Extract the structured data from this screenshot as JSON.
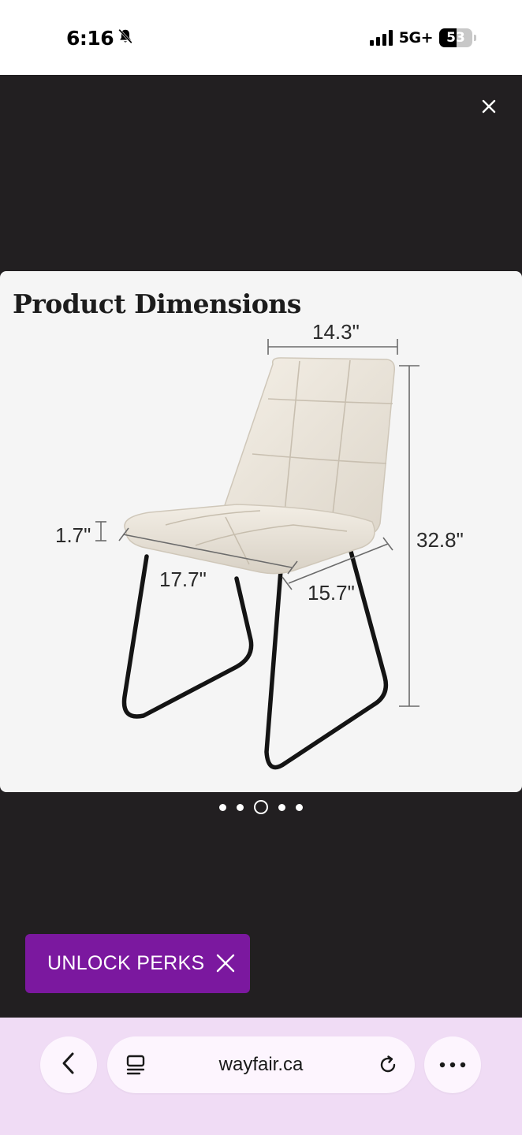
{
  "status_bar": {
    "time": "6:16",
    "network": "5G+",
    "battery_level": "53",
    "battery_fraction": 0.53,
    "icons": [
      "bell-slash-icon",
      "signal-bars-icon",
      "battery-icon"
    ]
  },
  "viewer": {
    "close_icon": "close-icon",
    "image": {
      "title": "Product Dimensions",
      "dimensions": {
        "width": "14.3\"",
        "height": "32.8\"",
        "seat_thickness": "1.7\"",
        "seat_width": "17.7\"",
        "seat_depth": "15.7\""
      }
    },
    "carousel": {
      "count": 5,
      "active_index": 2
    }
  },
  "promo": {
    "label": "UNLOCK PERKS",
    "close_icon": "close-icon",
    "color": "#7b189f"
  },
  "browser": {
    "url": "wayfair.ca",
    "back_icon": "chevron-left-icon",
    "tabs_icon": "page-layout-icon",
    "reload_icon": "reload-icon",
    "menu_icon": "more-horizontal-icon",
    "bar_color": "#f0dcf5"
  }
}
